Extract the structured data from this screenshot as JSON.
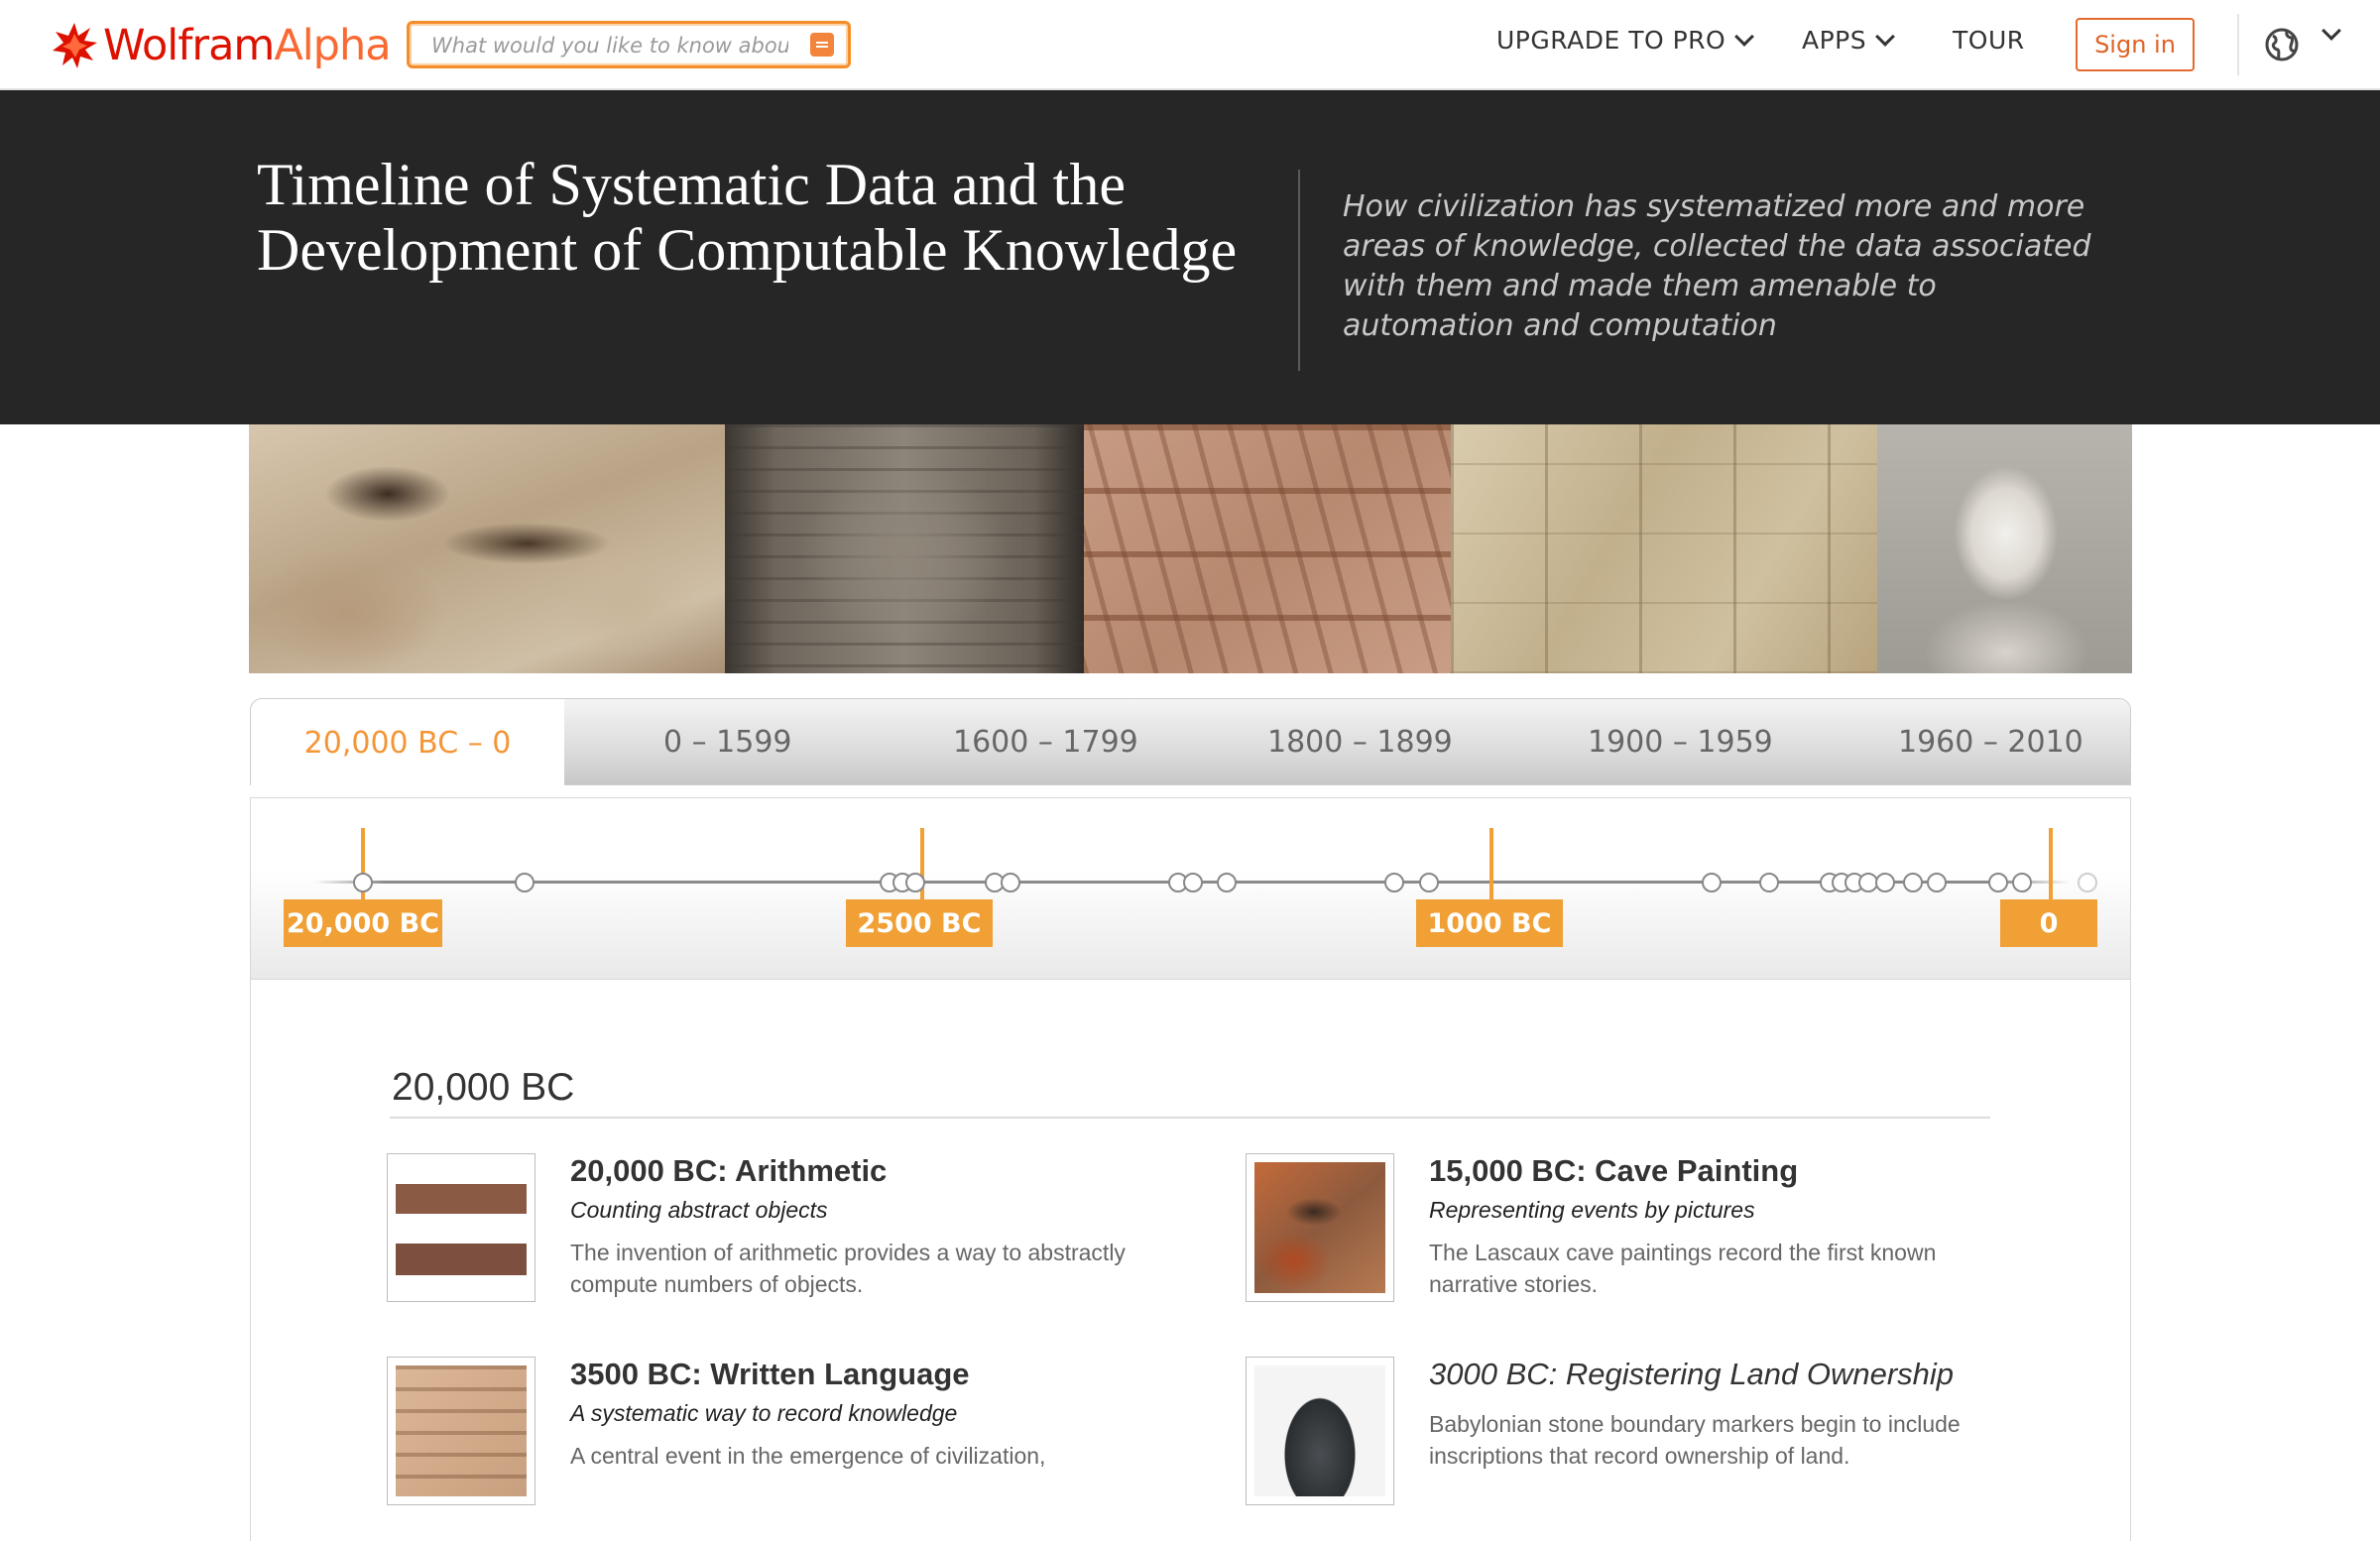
{
  "nav": {
    "logo_wolfram": "Wolfram",
    "logo_alpha": "Alpha",
    "search_placeholder": "What would you like to know about?",
    "upgrade": "UPGRADE TO PRO",
    "apps": "APPS",
    "tour": "TOUR",
    "sign_in": "Sign in"
  },
  "hero": {
    "title": "Timeline of Systematic Data and the Development of Computable Knowledge",
    "subtitle": "How civilization has systematized more and more areas of knowledge, collected the data associated with them and made them amenable to automation and computation"
  },
  "tabs": [
    "20,000 BC – 0",
    "0 – 1599",
    "1600 – 1799",
    "1800 – 1899",
    "1900 – 1959",
    "1960 – 2010"
  ],
  "timeline": {
    "labels": [
      "20,000 BC",
      "2500 BC",
      "1000 BC",
      "0"
    ]
  },
  "section": {
    "heading": "20,000 BC",
    "entries": [
      {
        "title": "20,000 BC: Arithmetic",
        "subtitle": "Counting abstract objects",
        "desc": "The invention of arithmetic provides a way to abstractly compute numbers of objects."
      },
      {
        "title": "15,000 BC: Cave Painting",
        "subtitle": "Representing events by pictures",
        "desc": "The Lascaux cave paintings record the first known narrative stories."
      },
      {
        "title": "3500 BC: Written Language",
        "subtitle": "A systematic way to record knowledge",
        "desc": "A central event in the emergence of civilization,"
      },
      {
        "title": "3000 BC: Registering Land Ownership",
        "subtitle": "",
        "desc": "Babylonian stone boundary markers begin to include inscriptions that record ownership of land."
      }
    ]
  },
  "colors": {
    "accent": "#f0a035",
    "brand_red": "#dd1100",
    "brand_orange": "#f96932",
    "hero_bg": "#262626"
  },
  "icons": [
    "wolfram-spikey-logo-icon",
    "search-submit-icon",
    "chevron-down-icon",
    "globe-icon"
  ]
}
